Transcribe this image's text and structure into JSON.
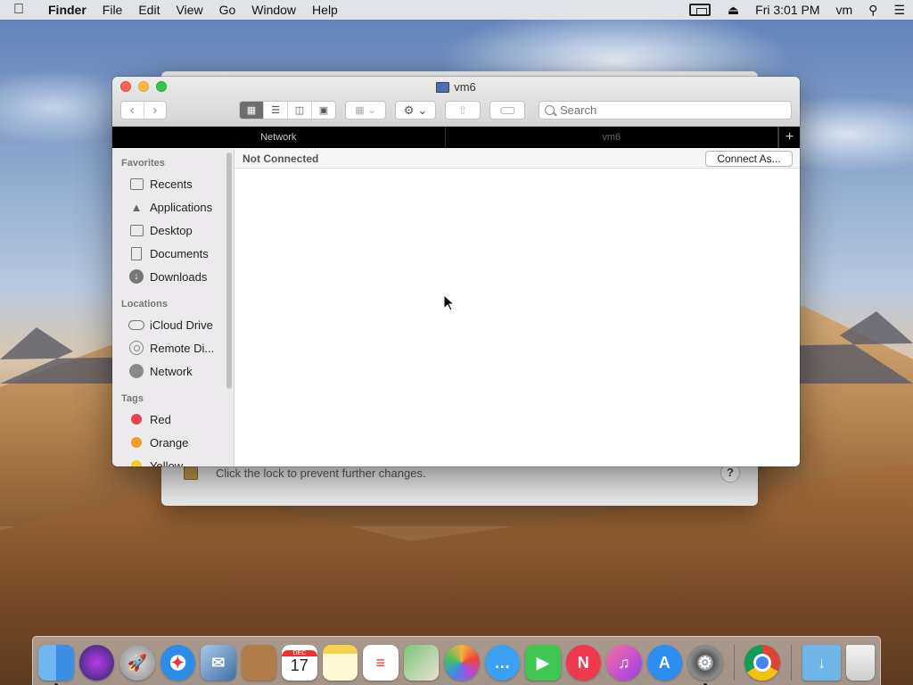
{
  "menubar": {
    "app_name": "Finder",
    "menus": [
      "File",
      "Edit",
      "View",
      "Go",
      "Window",
      "Help"
    ],
    "clock": "Fri 3:01 PM",
    "user": "vm"
  },
  "finder": {
    "title": "vm6",
    "search_placeholder": "Search",
    "tabs": [
      "Network",
      "vm6"
    ],
    "tab_add": "+",
    "status": "Not Connected",
    "connect_button": "Connect As...",
    "sidebar": {
      "favorites_header": "Favorites",
      "favorites": [
        {
          "label": "Recents",
          "icon": "recents-icon"
        },
        {
          "label": "Applications",
          "icon": "applications-icon"
        },
        {
          "label": "Desktop",
          "icon": "desktop-icon"
        },
        {
          "label": "Documents",
          "icon": "documents-icon"
        },
        {
          "label": "Downloads",
          "icon": "downloads-icon"
        }
      ],
      "locations_header": "Locations",
      "locations": [
        {
          "label": "iCloud Drive",
          "icon": "icloud-icon"
        },
        {
          "label": "Remote Di...",
          "icon": "remote-disc-icon"
        },
        {
          "label": "Network",
          "icon": "network-icon"
        }
      ],
      "tags_header": "Tags",
      "tags": [
        {
          "label": "Red",
          "color": "#e9434a"
        },
        {
          "label": "Orange",
          "color": "#f39a2b"
        },
        {
          "label": "Yellow",
          "color": "#f2cd2e"
        }
      ]
    }
  },
  "back_window": {
    "lock_text": "Click the lock to prevent further changes.",
    "help": "?"
  },
  "dock": {
    "calendar_month": "DEC",
    "calendar_day": "17"
  }
}
